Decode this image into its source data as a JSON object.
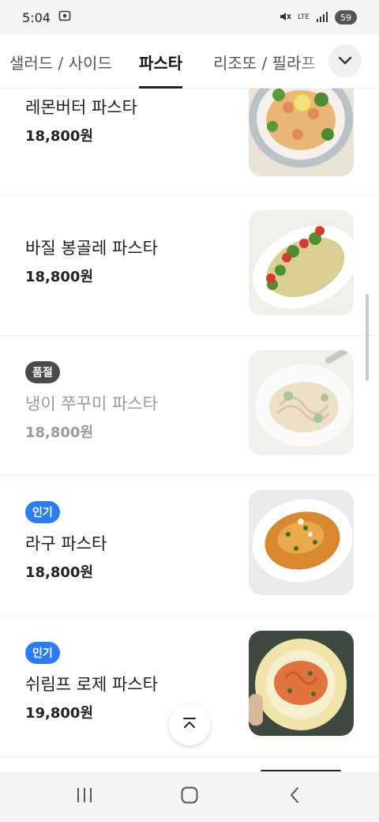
{
  "status_bar": {
    "time": "5:04",
    "network": "LTE",
    "battery": "59"
  },
  "tabs": [
    {
      "label": "샐러드 / 사이드",
      "active": false
    },
    {
      "label": "파스타",
      "active": true
    },
    {
      "label": "리조또 / 필라프",
      "active": false
    }
  ],
  "menu": {
    "items": [
      {
        "name": "레몬버터 파스타",
        "price": "18,800원",
        "badge": ""
      },
      {
        "name": "바질 봉골레 파스타",
        "price": "18,800원",
        "badge": ""
      },
      {
        "name": "냉이 쭈꾸미 파스타",
        "price": "18,800원",
        "badge": "품절"
      },
      {
        "name": "라구 파스타",
        "price": "18,800원",
        "badge": "인기"
      },
      {
        "name": "쉬림프 로제 파스타",
        "price": "19,800원",
        "badge": "인기"
      }
    ]
  },
  "colors": {
    "popular_badge": "#2b7cf2",
    "soldout_badge": "#4a4a4a",
    "active_tab_underline": "#222222"
  },
  "icons": {
    "expand": "chevron-down-icon",
    "scroll_top": "chevron-up-icon",
    "nav_recents": "recents-icon",
    "nav_home": "home-icon",
    "nav_back": "back-icon"
  }
}
